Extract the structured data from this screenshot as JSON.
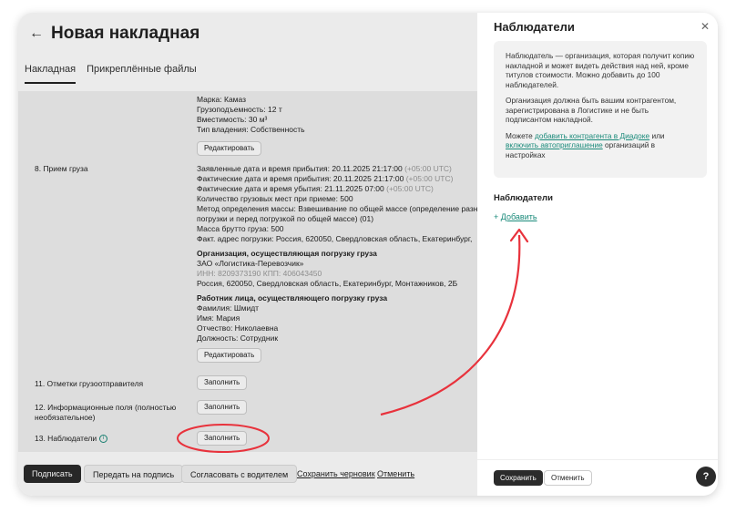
{
  "header": {
    "title": "Новая накладная",
    "back_icon": "arrow-left-icon"
  },
  "tabs": [
    {
      "label": "Накладная",
      "active": true
    },
    {
      "label": "Прикреплённые файлы",
      "active": false
    }
  ],
  "vehicle": {
    "lines": [
      "Марка: Камаз",
      "Грузоподъемность: 12 т",
      "Вместимость: 30 м³",
      "Тип владения: Собственность"
    ],
    "edit_label": "Редактировать"
  },
  "section8": {
    "label": "8. Прием груза",
    "declared": {
      "label": "Заявленные дата и время прибытия:",
      "date": "20.11.2025",
      "time": "21:17:00",
      "tz": "(+05:00 UTC)"
    },
    "actual_arrival": {
      "label": "Фактические дата и время прибытия:",
      "date": "20.11.2025",
      "time": "21:17:00",
      "tz": "(+05:00 UTC)"
    },
    "actual_departure": {
      "label": "Фактические дата и время убытия:",
      "date": "21.11.2025",
      "time": "07:00",
      "tz": "(+05:00 UTC)"
    },
    "lines": [
      "Количество грузовых мест при приеме: 500",
      "Метод определения массы: Взвешивание по общей массе (определение разн",
      "погрузки и перед погрузкой по общей массе) (01)",
      "Масса брутто груза: 500",
      "Факт. адрес погрузки: Россия, 620050, Свердловская область, Екатеринбург,"
    ],
    "org_title": "Организация, осуществляющая погрузку груза",
    "org_name": "ЗАО «Логистика-Перевозчик»",
    "org_ids": "ИНН: 8209373190 КПП: 406043450",
    "org_address": "Россия, 620050, Свердловская область, Екатеринбург, Монтажников, 2Б",
    "worker_title": "Работник лица, осуществляющего погрузку груза",
    "worker_lines": [
      "Фамилия: Шмидт",
      "Имя: Мария",
      "Отчество: Николаевна",
      "Должность: Сотрудник"
    ],
    "edit_label": "Редактировать"
  },
  "section11": {
    "label": "11. Отметки грузоотправителя",
    "button": "Заполнить"
  },
  "section12": {
    "label": "12. Информационные поля (полностью необязательное)",
    "button": "Заполнить"
  },
  "section13": {
    "label": "13. Наблюдатели",
    "button": "Заполнить",
    "info_icon": "info-icon"
  },
  "footer": {
    "sign": "Подписать",
    "send_sign": "Передать на подпись",
    "agree_driver": "Согласовать с водителем",
    "save_draft": "Сохранить черновик",
    "cancel": "Отменить"
  },
  "side": {
    "title": "Наблюдатели",
    "close_icon": "close-icon",
    "info_p1": "Наблюдатель — организация, которая получит копию накладной и может видеть действия над ней, кроме титулов стоимости. Можно добавить до 100 наблюдателей.",
    "info_p2": "Организация должна быть вашим контрагентом, зарегистрирована в Логистике и не быть подписантом накладной.",
    "info_p3_a": "Можете ",
    "info_p3_link1": "добавить контрагента в Диадоке",
    "info_p3_b": " или ",
    "info_p3_link2": "включить автоприглашение",
    "info_p3_c": " организаций в настройках",
    "observers_title": "Наблюдатели",
    "add_label": "Добавить",
    "save": "Сохранить",
    "cancel": "Отменить",
    "help": "?"
  },
  "colors": {
    "accent": "#1a8a7a",
    "annotation": "#e8323c",
    "dark": "#2b2b2b"
  }
}
